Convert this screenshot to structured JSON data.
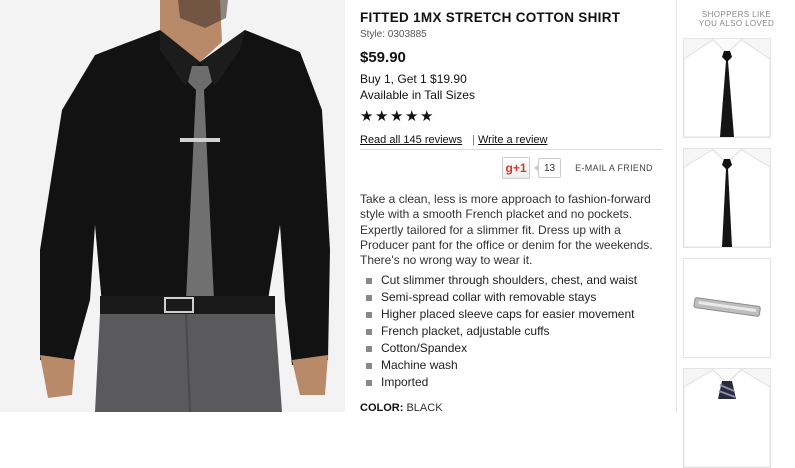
{
  "product": {
    "title": "FITTED 1MX STRETCH COTTON SHIRT",
    "style": "Style: 0303885",
    "price": "$59.90",
    "promo": "Buy 1, Get 1 $19.90",
    "availability": "Available in Tall Sizes",
    "rating": 5,
    "reviews_link": "Read all 145 reviews",
    "separator": "|",
    "write_review": "Write a review",
    "gplus_label": "g+1",
    "gplus_count": "13",
    "email_friend": "E-MAIL A FRIEND",
    "description": "Take a clean, less is more approach to fashion-forward style with a smooth French placket and no pockets. Expertly tailored for a slimmer fit. Dress up with a Producer pant for the office or denim for the weekends. There's no wrong way to wear it.",
    "features": [
      "Cut slimmer through shoulders, chest, and waist",
      "Semi-spread collar with removable stays",
      "Higher placed sleeve caps for easier movement",
      "French placket, adjustable cuffs",
      "Cotton/Spandex",
      "Machine wash",
      "Imported"
    ],
    "color_label": "COLOR:",
    "color_value": "BLACK"
  },
  "rail": {
    "title_line1": "SHOPPERS LIKE",
    "title_line2": "YOU ALSO LOVED",
    "items": [
      {
        "name": "black-tie-thumbnail"
      },
      {
        "name": "black-skinny-tie-thumbnail"
      },
      {
        "name": "tie-bar-thumbnail"
      },
      {
        "name": "striped-tie-thumbnail"
      }
    ]
  },
  "colors": {
    "shirt": "#121212",
    "tie": "#6d6d6d",
    "pants": "#5a5a5c",
    "skin": "#b98a6a",
    "gplus_red": "#d6392c"
  },
  "icons": {
    "star": "★",
    "bullet": "square-bullet"
  }
}
